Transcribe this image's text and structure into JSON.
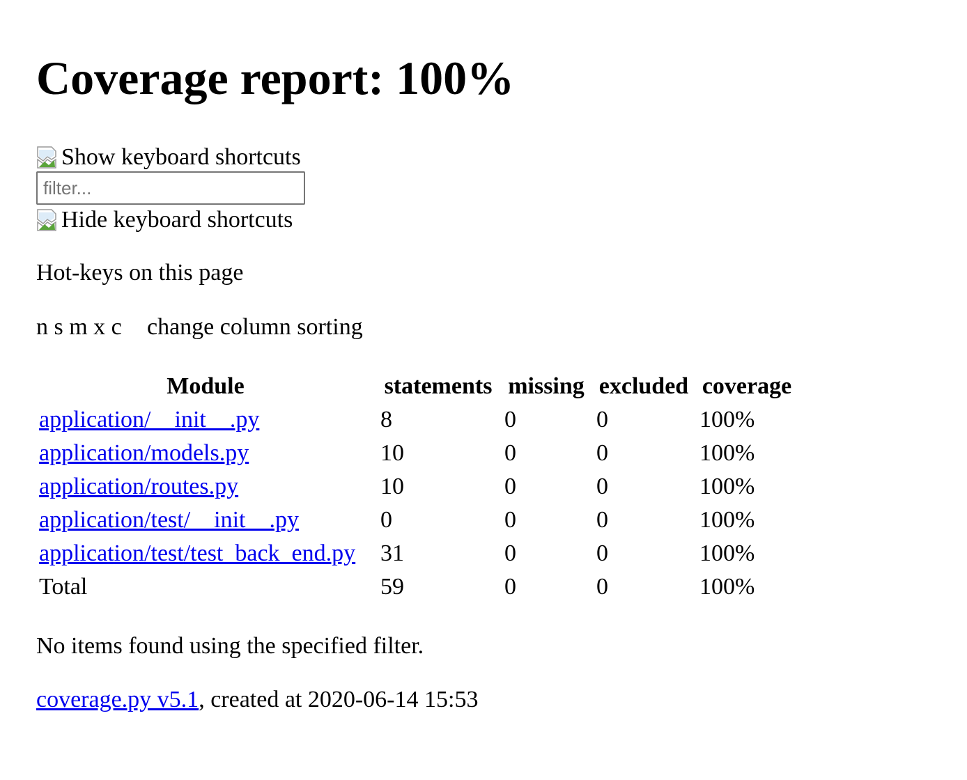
{
  "header": {
    "title": "Coverage report: 100%"
  },
  "keyboard": {
    "show_label": "Show keyboard shortcuts",
    "hide_label": "Hide keyboard shortcuts",
    "icon": "broken-image-icon"
  },
  "filter": {
    "placeholder": "filter...",
    "value": ""
  },
  "hotkeys": {
    "heading": "Hot-keys on this page",
    "keys": "n s m x c",
    "description": "change column sorting"
  },
  "table": {
    "columns": [
      "Module",
      "statements",
      "missing",
      "excluded",
      "coverage"
    ],
    "rows": [
      {
        "module": "application/__init__.py",
        "statements": "8",
        "missing": "0",
        "excluded": "0",
        "coverage": "100%"
      },
      {
        "module": "application/models.py",
        "statements": "10",
        "missing": "0",
        "excluded": "0",
        "coverage": "100%"
      },
      {
        "module": "application/routes.py",
        "statements": "10",
        "missing": "0",
        "excluded": "0",
        "coverage": "100%"
      },
      {
        "module": "application/test/__init__.py",
        "statements": "0",
        "missing": "0",
        "excluded": "0",
        "coverage": "100%"
      },
      {
        "module": "application/test/test_back_end.py",
        "statements": "31",
        "missing": "0",
        "excluded": "0",
        "coverage": "100%"
      }
    ],
    "total": {
      "module": "Total",
      "statements": "59",
      "missing": "0",
      "excluded": "0",
      "coverage": "100%"
    }
  },
  "no_match": "No items found using the specified filter.",
  "footer": {
    "link_text": "coverage.py v5.1",
    "suffix": ", created at 2020-06-14 15:53"
  },
  "colors": {
    "link": "#0000ee",
    "text": "#000000",
    "background": "#ffffff"
  }
}
